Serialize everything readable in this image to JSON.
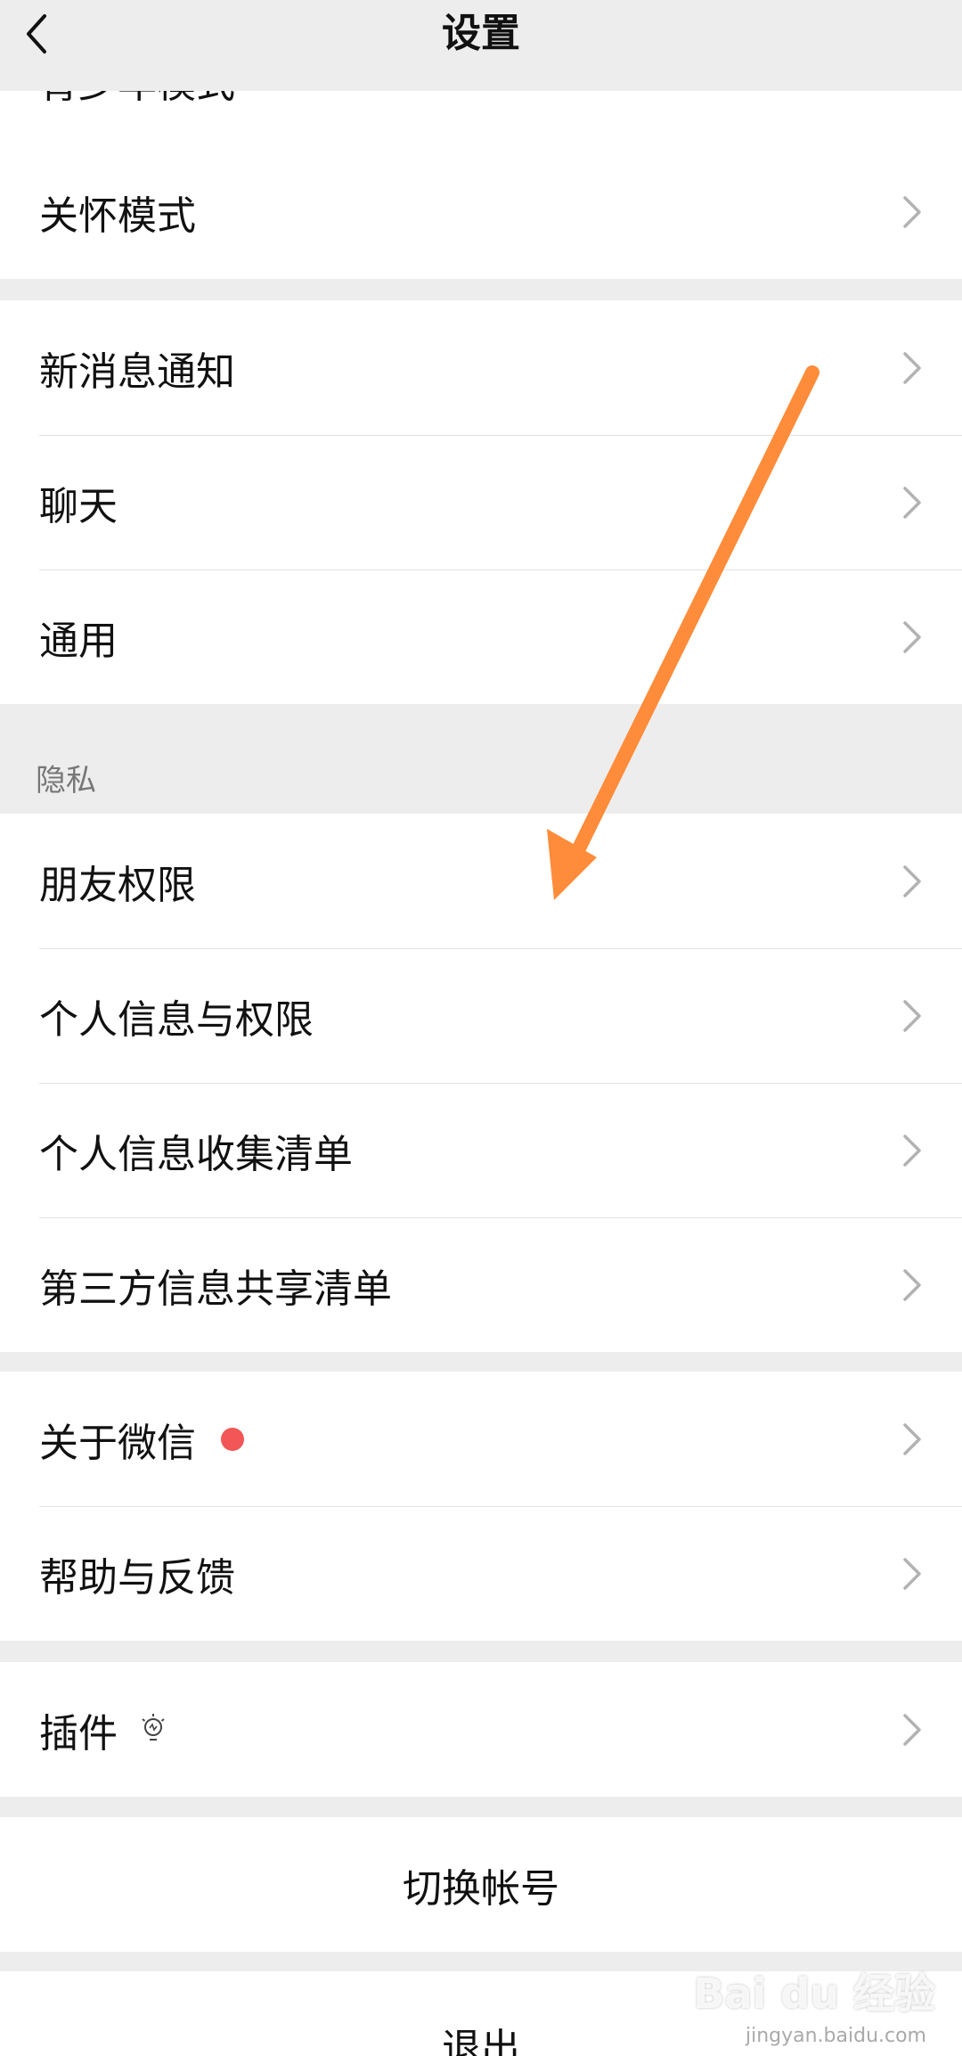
{
  "header": {
    "title": "设置"
  },
  "cut_item": {
    "label": "青少年模式"
  },
  "group1": [
    {
      "label": "关怀模式"
    }
  ],
  "group2": [
    {
      "label": "新消息通知"
    },
    {
      "label": "聊天"
    },
    {
      "label": "通用"
    }
  ],
  "privacy": {
    "section_label": "隐私",
    "items": [
      {
        "label": "朋友权限"
      },
      {
        "label": "个人信息与权限"
      },
      {
        "label": "个人信息收集清单"
      },
      {
        "label": "第三方信息共享清单"
      }
    ]
  },
  "group4": [
    {
      "label": "关于微信"
    },
    {
      "label": "帮助与反馈"
    }
  ],
  "group5": [
    {
      "label": "插件"
    }
  ],
  "actions": {
    "switch_account": "切换帐号",
    "logout": "退出"
  },
  "watermark": {
    "text": "Bai du 经验",
    "sub": "jingyan.baidu.com"
  },
  "colors": {
    "accent_arrow": "#ff8c3a",
    "badge_red": "#f25656",
    "background": "#ededed"
  },
  "icons": {
    "back": "chevron-left-icon",
    "row": "chevron-right-icon",
    "badge": "red-dot-icon",
    "plugin": "lightbulb-icon"
  }
}
